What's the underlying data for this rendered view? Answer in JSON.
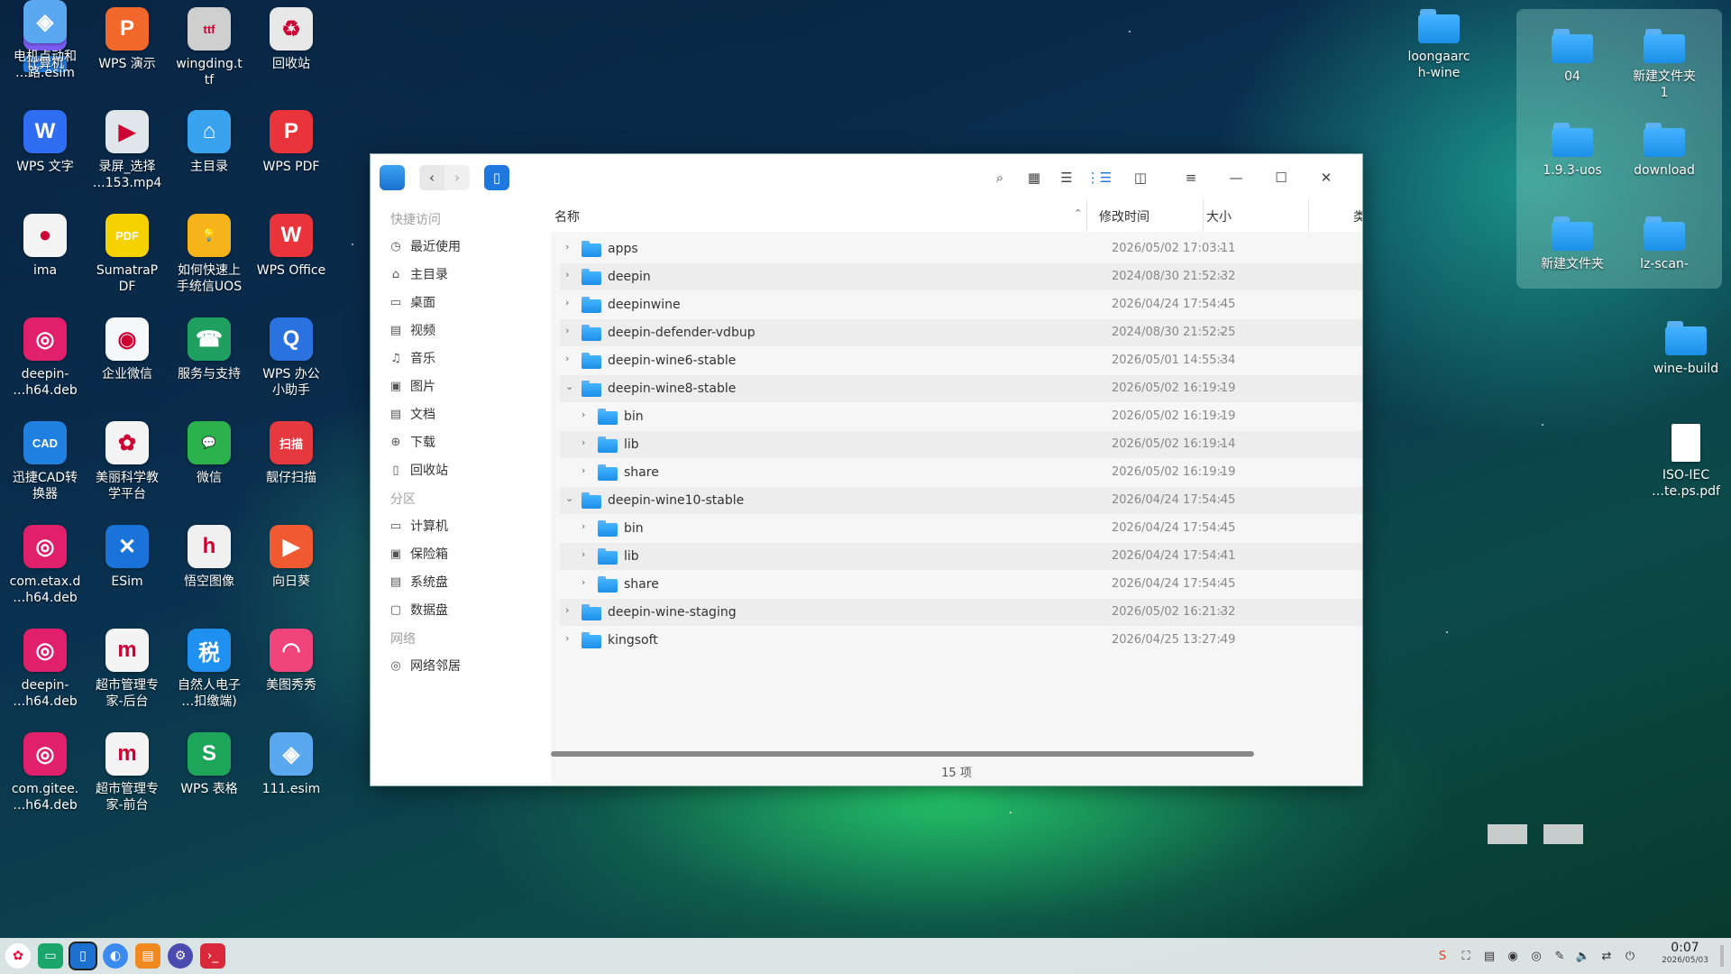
{
  "desktop": {
    "icons": [
      {
        "label": "计算机",
        "glyph": "▭",
        "color": "#7a5af0",
        "selected": true
      },
      {
        "label": "WPS 演示",
        "glyph": "P",
        "color": "#f2672a"
      },
      {
        "label": "wingding.t\ntf",
        "glyph": "ttf",
        "color": "#cfcfcf"
      },
      {
        "label": "回收站",
        "glyph": "♻",
        "color": "#e8e8e8"
      },
      {
        "label": "WPS 文字",
        "glyph": "W",
        "color": "#2f6ef2"
      },
      {
        "label": "录屏_选择\n…153.mp4",
        "glyph": "▶",
        "color": "#e0e6ea"
      },
      {
        "label": "主目录",
        "glyph": "⌂",
        "color": "#3aa3f0"
      },
      {
        "label": "WPS PDF",
        "glyph": "P",
        "color": "#e8343a"
      },
      {
        "label": "ima",
        "glyph": "●",
        "color": "#f4f4f4"
      },
      {
        "label": "SumatraP\nDF",
        "glyph": "PDF",
        "color": "#f5d100"
      },
      {
        "label": "如何快速上\n手统信UOS",
        "glyph": "💡",
        "color": "#f6b31a"
      },
      {
        "label": "WPS Office",
        "glyph": "W",
        "color": "#e8343a"
      },
      {
        "label": "deepin-\n…h64.deb",
        "glyph": "◎",
        "color": "#e0206a"
      },
      {
        "label": "企业微信",
        "glyph": "◉",
        "color": "#f4f8fb"
      },
      {
        "label": "服务与支持",
        "glyph": "☎",
        "color": "#20a060"
      },
      {
        "label": "WPS 办公\n小助手",
        "glyph": "Q",
        "color": "#2a72e0"
      },
      {
        "label": "迅捷CAD转\n换器",
        "glyph": "CAD",
        "color": "#2080e0"
      },
      {
        "label": "美丽科学教\n学平台",
        "glyph": "✿",
        "color": "#f4f4f4"
      },
      {
        "label": "微信",
        "glyph": "💬",
        "color": "#2bb24c"
      },
      {
        "label": "靓仔扫描",
        "glyph": "扫描",
        "color": "#e6393f"
      },
      {
        "label": "com.etax.d\n…h64.deb",
        "glyph": "◎",
        "color": "#e0206a"
      },
      {
        "label": "ESim",
        "glyph": "✕",
        "color": "#1a73d8"
      },
      {
        "label": "悟空图像",
        "glyph": "h",
        "color": "#f0f0f0"
      },
      {
        "label": "向日葵",
        "glyph": "▶",
        "color": "#f05a30"
      },
      {
        "label": "deepin-\n…h64.deb",
        "glyph": "◎",
        "color": "#e0206a"
      },
      {
        "label": "超市管理专\n家-后台",
        "glyph": "m",
        "color": "#f4f4f4"
      },
      {
        "label": "自然人电子\n…扣缴端)",
        "glyph": "税",
        "color": "#1f8ff0"
      },
      {
        "label": "美图秀秀",
        "glyph": "◠",
        "color": "#f0457a"
      },
      {
        "label": "com.gitee.\n…h64.deb",
        "glyph": "◎",
        "color": "#e0206a"
      },
      {
        "label": "超市管理专\n家-前台",
        "glyph": "m",
        "color": "#f4f4f4"
      },
      {
        "label": "WPS 表格",
        "glyph": "S",
        "color": "#1da55a"
      },
      {
        "label": "111.esim",
        "glyph": "◈",
        "color": "#5aa8f0"
      },
      {
        "label": "电机点动和\n…路.esim",
        "glyph": "◈",
        "color": "#5aa8f0"
      }
    ],
    "right_icons": [
      {
        "label": "loongaarc\nh-wine"
      },
      {
        "label": "04"
      },
      {
        "label": "新建文件夹\n1"
      },
      {
        "label": "1.9.3-uos"
      },
      {
        "label": "download"
      },
      {
        "label": "新建文件夹"
      },
      {
        "label": "lz-scan-"
      },
      {
        "label": "wine-build"
      },
      {
        "label": "ISO-IEC\n…te.ps.pdf"
      }
    ]
  },
  "window": {
    "sidebar": {
      "group_quick": "快捷访问",
      "quick": [
        {
          "label": "最近使用",
          "icon": "clock-icon",
          "glyph": "◷"
        },
        {
          "label": "主目录",
          "icon": "home-icon",
          "glyph": "⌂"
        },
        {
          "label": "桌面",
          "icon": "desktop-icon",
          "glyph": "▭"
        },
        {
          "label": "视频",
          "icon": "video-icon",
          "glyph": "▤"
        },
        {
          "label": "音乐",
          "icon": "music-icon",
          "glyph": "♫"
        },
        {
          "label": "图片",
          "icon": "picture-icon",
          "glyph": "▣"
        },
        {
          "label": "文档",
          "icon": "document-icon",
          "glyph": "▤"
        },
        {
          "label": "下载",
          "icon": "download-icon",
          "glyph": "⊕"
        },
        {
          "label": "回收站",
          "icon": "trash-icon",
          "glyph": "▯"
        }
      ],
      "group_partition": "分区",
      "partitions": [
        {
          "label": "计算机",
          "icon": "computer-icon",
          "glyph": "▭"
        },
        {
          "label": "保险箱",
          "icon": "vault-icon",
          "glyph": "▣"
        },
        {
          "label": "系统盘",
          "icon": "disk-icon",
          "glyph": "▤"
        },
        {
          "label": "数据盘",
          "icon": "disk-icon",
          "glyph": "▢"
        }
      ],
      "group_network": "网络",
      "network": [
        {
          "label": "网络邻居",
          "icon": "network-icon",
          "glyph": "◎"
        }
      ]
    },
    "columns": {
      "name": "名称",
      "modified": "修改时间",
      "size": "大小",
      "type": "类"
    },
    "rows": [
      {
        "name": "apps",
        "date": "2026/05/02 17:03:11",
        "size": "-",
        "level": 0,
        "expanded": false
      },
      {
        "name": "deepin",
        "date": "2024/08/30 21:52:32",
        "size": "-",
        "level": 0,
        "expanded": false
      },
      {
        "name": "deepinwine",
        "date": "2026/04/24 17:54:45",
        "size": "-",
        "level": 0,
        "expanded": false
      },
      {
        "name": "deepin-defender-vdbup",
        "date": "2024/08/30 21:52:25",
        "size": "-",
        "level": 0,
        "expanded": false
      },
      {
        "name": "deepin-wine6-stable",
        "date": "2026/05/01 14:55:34",
        "size": "-",
        "level": 0,
        "expanded": false
      },
      {
        "name": "deepin-wine8-stable",
        "date": "2026/05/02 16:19:19",
        "size": "-",
        "level": 0,
        "expanded": true
      },
      {
        "name": "bin",
        "date": "2026/05/02 16:19:19",
        "size": "-",
        "level": 1,
        "expanded": false
      },
      {
        "name": "lib",
        "date": "2026/05/02 16:19:14",
        "size": "-",
        "level": 1,
        "expanded": false
      },
      {
        "name": "share",
        "date": "2026/05/02 16:19:19",
        "size": "-",
        "level": 1,
        "expanded": false
      },
      {
        "name": "deepin-wine10-stable",
        "date": "2026/04/24 17:54:45",
        "size": "-",
        "level": 0,
        "expanded": true
      },
      {
        "name": "bin",
        "date": "2026/04/24 17:54:45",
        "size": "-",
        "level": 1,
        "expanded": false
      },
      {
        "name": "lib",
        "date": "2026/04/24 17:54:41",
        "size": "-",
        "level": 1,
        "expanded": false
      },
      {
        "name": "share",
        "date": "2026/04/24 17:54:45",
        "size": "-",
        "level": 1,
        "expanded": false
      },
      {
        "name": "deepin-wine-staging",
        "date": "2026/05/02 16:21:32",
        "size": "-",
        "level": 0,
        "expanded": false
      },
      {
        "name": "kingsoft",
        "date": "2026/04/25 13:27:49",
        "size": "-",
        "level": 0,
        "expanded": false
      }
    ],
    "status": "15 项"
  },
  "taskbar": {
    "time": "0:07",
    "date": "2026/05/03"
  },
  "colors": {
    "accent": "#1f78e0",
    "folder": "#2b9af0"
  }
}
